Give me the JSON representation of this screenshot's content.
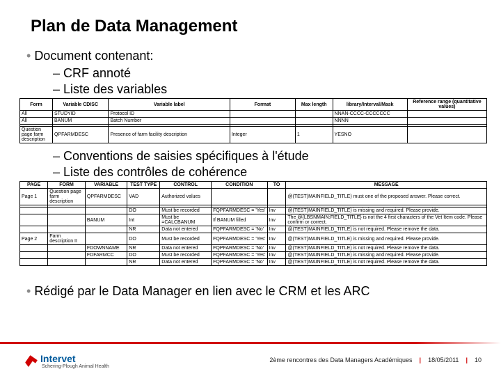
{
  "title": "Plan de Data Management",
  "bullets": {
    "l1_1": "Document contenant:",
    "l2_1": "CRF annoté",
    "l2_2": "Liste des variables",
    "l2_3": "Conventions de saisies spécifiques à l'étude",
    "l2_4": "Liste des contrôles de cohérence",
    "l1_2": "Rédigé par le Data Manager en lien avec le CRM et les ARC"
  },
  "table1": {
    "headers": [
      "Form",
      "Variable CDISC",
      "Variable label",
      "Format",
      "Max length",
      "library/Interval/Mask",
      "Reference range (quantitative values)"
    ],
    "rows": [
      [
        "All",
        "STUDYID",
        "Protocol ID",
        "",
        "",
        "NNAN-CCCC-CCCCCCC",
        ""
      ],
      [
        "All",
        "BANUM",
        "Batch Number",
        "",
        "",
        "NNNN",
        ""
      ],
      [
        "",
        "",
        "",
        "",
        "",
        "",
        ""
      ],
      [
        "Question page farm description",
        "QPFARMDESC",
        "Presence of farm facility description",
        "Integer",
        "1",
        "YESNO",
        ""
      ]
    ]
  },
  "table2": {
    "headers": [
      "PAGE",
      "FORM",
      "VARIABLE",
      "TEST TYPE",
      "CONTROL",
      "CONDITION",
      "TO",
      "MESSAGE"
    ],
    "rows": [
      [
        "Page 1",
        "Question page farm description",
        "QPFARMDESC",
        "VAD",
        "Authorized values",
        "",
        "",
        "@(TEST)MAINFIELD_TITLE) must one of the proposed answer. Please correct."
      ],
      [
        "",
        "",
        "",
        "",
        "",
        "",
        "",
        ""
      ],
      [
        "",
        "",
        "",
        "DO",
        "Must be recorded",
        "FQPFARMDESC = 'Yes'",
        "Inv",
        "@(TEST)MAINFIELD_TITLE) is missing and required. Please provide."
      ],
      [
        "",
        "",
        "BANUM",
        "Int",
        "Must be =CALCBANUM",
        "If BANUM filled",
        "Inv",
        "The @{LBSNMAIN:FIELD_TITLE} is not the 4 first characters of the Vet Item code. Please confirm or correct."
      ],
      [
        "",
        "",
        "",
        "NR",
        "Data not entered",
        "FQPFARMDESC = 'No'",
        "Inv",
        "@(TEST)MAINFIELD_TITLE) is not required. Please remove the data."
      ],
      [
        "Page 2",
        "Farm description II",
        "",
        "DO",
        "Must be recorded",
        "FQPFARMDESC = 'Yes'",
        "Inv",
        "@(TEST)MAINFIELD_TITLE) is missing and required. Please provide."
      ],
      [
        "",
        "",
        "FDOWNNAME",
        "NR",
        "Data not entered",
        "FQPFARMDESC = 'No'",
        "Inv",
        "@(TEST)MAINFIELD_TITLE) is not required. Please remove the data."
      ],
      [
        "",
        "",
        "FDFARMCC",
        "DO",
        "Must be recorded",
        "FQPFARMDESC = 'Yes'",
        "Inv",
        "@(TEST)MAINFIELD_TITLE) is missing and required. Please provide."
      ],
      [
        "",
        "",
        "",
        "NR",
        "Data not entered",
        "FQPFARMDESC = 'No'",
        "Inv",
        "@(TEST)MAINFIELD_TITLE) is not required. Please remove the data."
      ]
    ]
  },
  "footer": {
    "logo_name": "Intervet",
    "logo_sub": "Schering-Plough Animal Health",
    "event": "2ème rencontres des Data Managers Académiques",
    "date": "18/05/2011",
    "page": "10"
  }
}
